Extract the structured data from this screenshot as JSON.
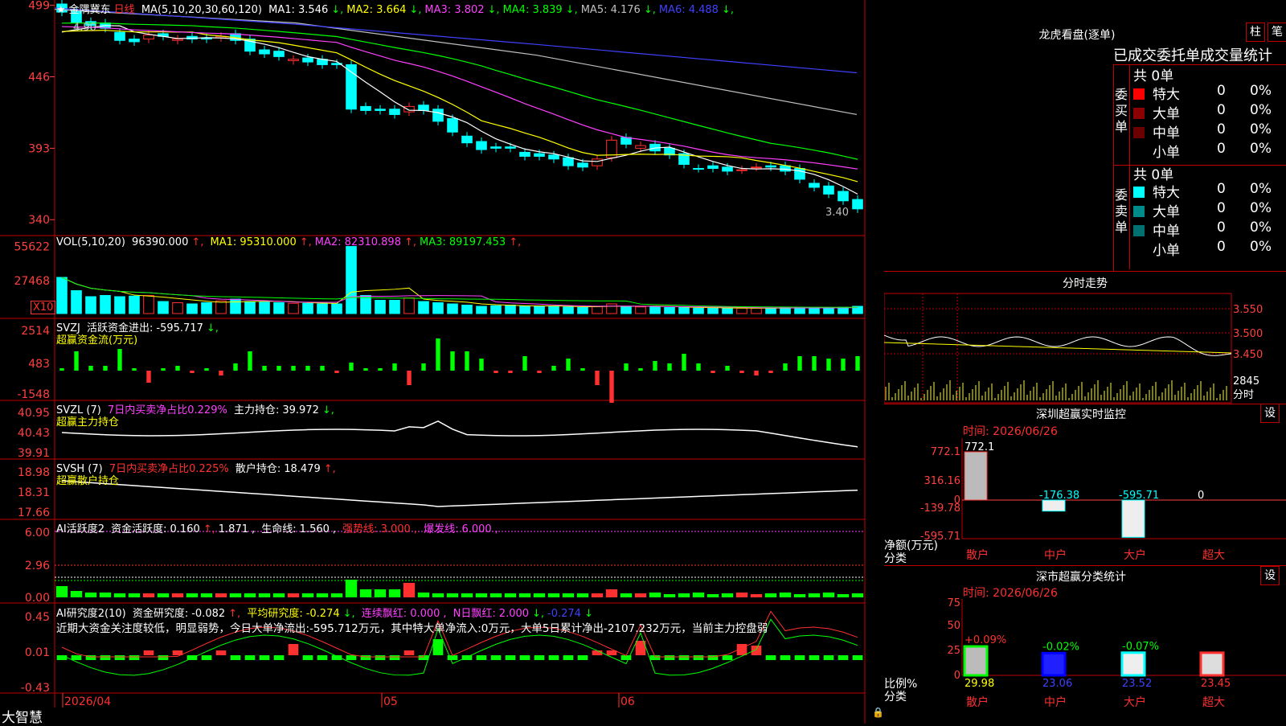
{
  "app_name": "大智慧",
  "stock": {
    "star": "★",
    "name": "金隅冀东",
    "period": "日线"
  },
  "price_panel": {
    "ma_header": "MA(5,10,20,30,60,120)",
    "ma": [
      {
        "label": "MA1:",
        "value": "3.546",
        "dir": "down",
        "color": "#ffffff"
      },
      {
        "label": "MA2:",
        "value": "3.664",
        "dir": "down",
        "color": "#ffff00"
      },
      {
        "label": "MA3:",
        "value": "3.802",
        "dir": "down",
        "color": "#ff40ff"
      },
      {
        "label": "MA4:",
        "value": "3.839",
        "dir": "down",
        "color": "#00ff00"
      },
      {
        "label": "MA5:",
        "value": "4.176",
        "dir": "down",
        "color": "#c0c0c0"
      },
      {
        "label": "MA6:",
        "value": "4.488",
        "dir": "down",
        "color": "#4040ff"
      }
    ],
    "y_ticks": [
      "499",
      "446",
      "393",
      "340"
    ],
    "high_label": "4.90",
    "low_label": "3.40"
  },
  "vol_panel": {
    "header": "VOL(5,10,20)",
    "value": "96390.000",
    "ma": [
      {
        "label": "MA1:",
        "value": "95310.000",
        "color": "#ffff00"
      },
      {
        "label": "MA2:",
        "value": "82310.898",
        "color": "#ff40ff"
      },
      {
        "label": "MA3:",
        "value": "89197.453",
        "color": "#00ff00"
      }
    ],
    "y_ticks": [
      "55622",
      "27468"
    ],
    "multiplier": "X10"
  },
  "svzj_panel": {
    "name": "SVZJ",
    "label": "活跃资金进出:",
    "value": "-595.717",
    "subtitle": "超赢资金流(万元)",
    "y_ticks": [
      "2514",
      "483",
      "-1548"
    ]
  },
  "svzl_panel": {
    "name": "SVZL (7)",
    "ratio": "7日内买卖净占比0.229%",
    "label": "主力持仓:",
    "value": "39.972",
    "subtitle": "超赢主力持仓",
    "y_ticks": [
      "40.95",
      "40.43",
      "39.91"
    ]
  },
  "svsh_panel": {
    "name": "SVSH (7)",
    "ratio": "7日内买卖净占比0.225%",
    "label": "散户持仓:",
    "value": "18.479",
    "subtitle": "超赢散户持仓",
    "y_ticks": [
      "18.98",
      "18.31",
      "17.66"
    ]
  },
  "ai_active_panel": {
    "name": "AI活跃度2",
    "label": "资金活跃度:",
    "v1": "0.160",
    "v2": "1.871",
    "life_label": "生命线:",
    "life": "1.560",
    "strong_label": "强势线:",
    "strong": "3.000",
    "burst_label": "爆发线:",
    "burst": "6.000",
    "y_ticks": [
      "6.00",
      "2.96",
      "0.00"
    ]
  },
  "ai_research_panel": {
    "name": "AI研究度2(10)",
    "label": "资金研究度:",
    "v1": "-0.082",
    "avg_label": "平均研究度:",
    "avg": "-0.274",
    "red_label": "连续飘红:",
    "red": "0.000",
    "nred_label": "N日飘红:",
    "nred": "2.000",
    "v5": "-0.274",
    "comment": "近期大资金关注度较低，明显弱势，今日大单净流出:-595.712万元，其中特大单净流入:0万元，大单5日累计净出-2107.232万元，当前主力控盘弱",
    "y_ticks": [
      "0.45",
      "0.01",
      "-0.43"
    ]
  },
  "x_axis": {
    "labels": [
      "2026/04",
      "05",
      "06"
    ]
  },
  "right": {
    "dragon_title": "龙虎看盘(逐单)",
    "btn_bar": "柱",
    "btn_pen": "笔",
    "stats_title": "已成交委托单成交量统计",
    "buy_side": "委买单",
    "sell_side": "委卖单",
    "total_buy": "共 0单",
    "total_sell": "共 0单",
    "buy_rows": [
      {
        "label": "特大",
        "color": "#ff0000",
        "n": "0",
        "pct": "0%"
      },
      {
        "label": "大单",
        "color": "#8b0000",
        "n": "0",
        "pct": "0%"
      },
      {
        "label": "中单",
        "color": "#6b0000",
        "n": "0",
        "pct": "0%"
      },
      {
        "label": "小单",
        "color": "#000000",
        "n": "0",
        "pct": "0%"
      }
    ],
    "sell_rows": [
      {
        "label": "特大",
        "color": "#00ffff",
        "n": "0",
        "pct": "0%"
      },
      {
        "label": "大单",
        "color": "#008b8b",
        "n": "0",
        "pct": "0%"
      },
      {
        "label": "中单",
        "color": "#007070",
        "n": "0",
        "pct": "0%"
      },
      {
        "label": "小单",
        "color": "#000000",
        "n": "0",
        "pct": "0%"
      }
    ],
    "intraday_title": "分时走势",
    "intraday_ticks": [
      "3.550",
      "3.500",
      "3.450"
    ],
    "intraday_vol": "2845",
    "intraday_tag": "分时",
    "sz_monitor_title": "深圳超赢实时监控",
    "sz_btn": "设",
    "sz_time": "时间: 2026/06/26",
    "sz_ticks": [
      "772.1",
      "316.16",
      "0",
      "-139.78",
      "-595.71"
    ],
    "sz_bars": [
      {
        "label": "散户",
        "value": "772.1"
      },
      {
        "label": "中户",
        "value": "-176.38"
      },
      {
        "label": "大户",
        "value": "-595.71"
      },
      {
        "label": "超大",
        "value": "0"
      }
    ],
    "sz_ylabel1": "净额(万元)",
    "sz_ylabel2": "分类",
    "class_title": "深市超赢分类统计",
    "class_btn": "设",
    "class_time": "时间: 2026/06/26",
    "class_ticks": [
      "75",
      "50",
      "25",
      "0"
    ],
    "class_bars": [
      {
        "label": "散户",
        "pct": "+0.09%",
        "value": "29.98"
      },
      {
        "label": "中户",
        "pct": "-0.02%",
        "value": "23.06"
      },
      {
        "label": "大户",
        "pct": "-0.07%",
        "value": "23.52"
      },
      {
        "label": "超大",
        "pct": "",
        "value": "23.45"
      }
    ],
    "class_ylabel1": "比例%",
    "class_ylabel2": "分类"
  },
  "chart_data": {
    "type": "candlestick",
    "dates": [
      "2026/04",
      "05",
      "06"
    ],
    "close": [
      4.94,
      4.86,
      4.84,
      4.82,
      4.73,
      4.72,
      4.77,
      4.76,
      4.74,
      4.74,
      4.74,
      4.76,
      4.73,
      4.65,
      4.63,
      4.61,
      4.59,
      4.57,
      4.55,
      4.55,
      4.22,
      4.21,
      4.21,
      4.18,
      4.24,
      4.21,
      4.13,
      4.05,
      3.97,
      3.92,
      3.93,
      3.93,
      3.87,
      3.87,
      3.85,
      3.8,
      3.79,
      3.85,
      3.99,
      3.96,
      3.95,
      3.91,
      3.88,
      3.81,
      3.78,
      3.78,
      3.76,
      3.77,
      3.79,
      3.79,
      3.76,
      3.7,
      3.64,
      3.59,
      3.54,
      3.48
    ],
    "volume": [
      30000,
      19000,
      14000,
      15000,
      14000,
      14500,
      15000,
      10000,
      9000,
      8000,
      9000,
      10500,
      12000,
      10000,
      9500,
      9000,
      8500,
      8500,
      8000,
      8000,
      55622,
      15000,
      11000,
      11000,
      13000,
      10000,
      9000,
      8000,
      7000,
      6000,
      6500,
      7000,
      6000,
      6000,
      6000,
      5500,
      5000,
      6000,
      8000,
      6000,
      5500,
      5500,
      5000,
      5000,
      4500,
      4500,
      4500,
      4500,
      4500,
      4500,
      5000,
      5000,
      5000,
      4800,
      5200,
      6000
    ]
  }
}
